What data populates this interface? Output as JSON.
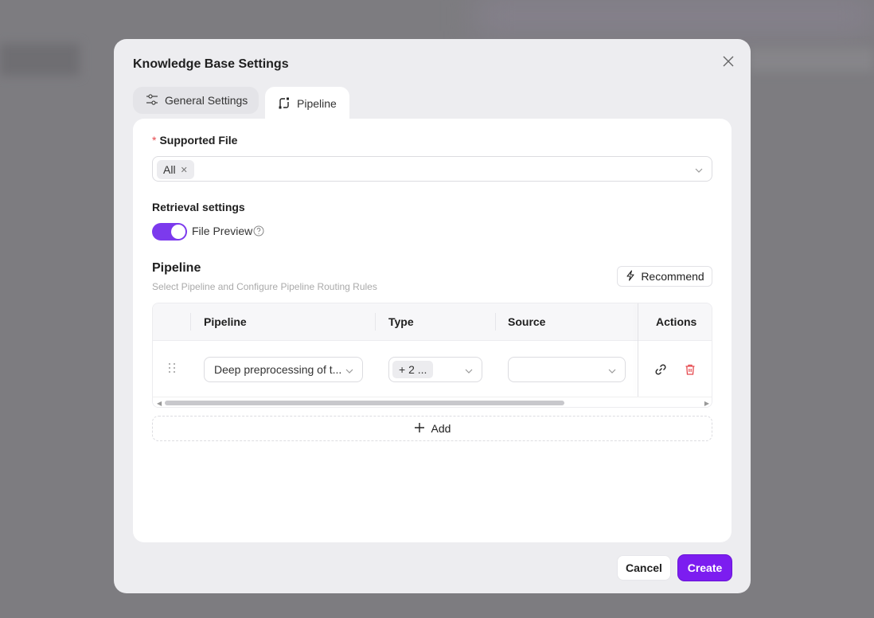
{
  "modal": {
    "title": "Knowledge Base Settings",
    "tabs": [
      {
        "label": "General Settings",
        "icon": "sliders-icon",
        "active": false
      },
      {
        "label": "Pipeline",
        "icon": "pipeline-icon",
        "active": true
      }
    ]
  },
  "supported_file": {
    "label": "Supported File",
    "required_mark": "*",
    "selected_tags": [
      "All"
    ]
  },
  "retrieval": {
    "label": "Retrieval settings",
    "file_preview_label": "File Preview",
    "file_preview_enabled": true
  },
  "pipeline": {
    "title": "Pipeline",
    "subtitle": "Select Pipeline and Configure Pipeline Routing Rules",
    "recommend_label": "Recommend",
    "columns": [
      "Pipeline",
      "Type",
      "Source",
      "Actions"
    ],
    "rows": [
      {
        "pipeline": "Deep preprocessing of t...",
        "type": "+ 2 ...",
        "source": ""
      }
    ],
    "add_label": "Add"
  },
  "footer": {
    "cancel_label": "Cancel",
    "create_label": "Create"
  },
  "colors": {
    "accent": "#7c1df0",
    "toggle": "#7c3aed",
    "danger": "#e5484d"
  }
}
